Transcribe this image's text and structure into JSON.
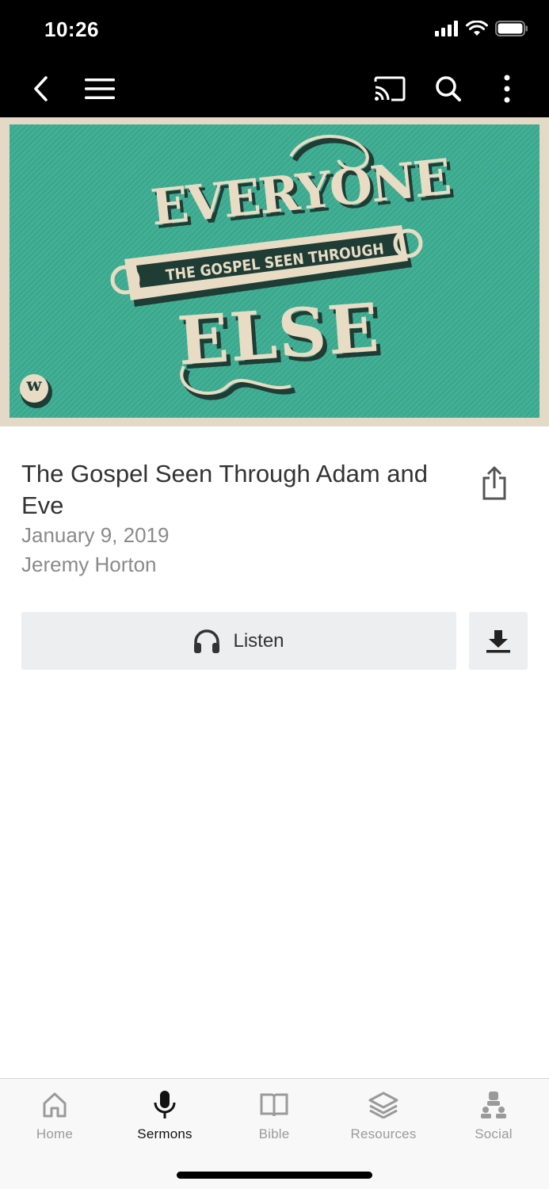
{
  "status_bar": {
    "time": "10:26",
    "icons": [
      "cellular-signal-icon",
      "wifi-icon",
      "battery-icon"
    ]
  },
  "nav_bar": {
    "left_icons": [
      "back-chevron-icon",
      "hamburger-menu-icon"
    ],
    "right_icons": [
      "cast-icon",
      "search-icon",
      "more-vertical-icon"
    ]
  },
  "hero": {
    "title_top": "EVERYONE",
    "banner": "THE GOSPEL SEEN THROUGH",
    "title_bottom": "ELSE",
    "logo_letter": "w",
    "colors": {
      "background": "#3dae93",
      "frame": "#e4d8c6",
      "lettering": "#e8dcc4",
      "shadow": "#1f3c35"
    }
  },
  "sermon": {
    "title": "The Gospel Seen Through Adam and Eve",
    "date": "January 9, 2019",
    "speaker": "Jeremy Horton"
  },
  "actions": {
    "share_icon": "share-icon",
    "listen_label": "Listen",
    "listen_icon": "headphones-icon",
    "download_icon": "download-icon"
  },
  "tabs": [
    {
      "label": "Home",
      "icon": "home-icon",
      "active": false
    },
    {
      "label": "Sermons",
      "icon": "microphone-icon",
      "active": true
    },
    {
      "label": "Bible",
      "icon": "book-icon",
      "active": false
    },
    {
      "label": "Resources",
      "icon": "layers-icon",
      "active": false
    },
    {
      "label": "Social",
      "icon": "people-icon",
      "active": false
    }
  ],
  "colors": {
    "accent_active": "#111111",
    "inactive": "#9a9a9a",
    "button_bg": "#eceef0"
  }
}
